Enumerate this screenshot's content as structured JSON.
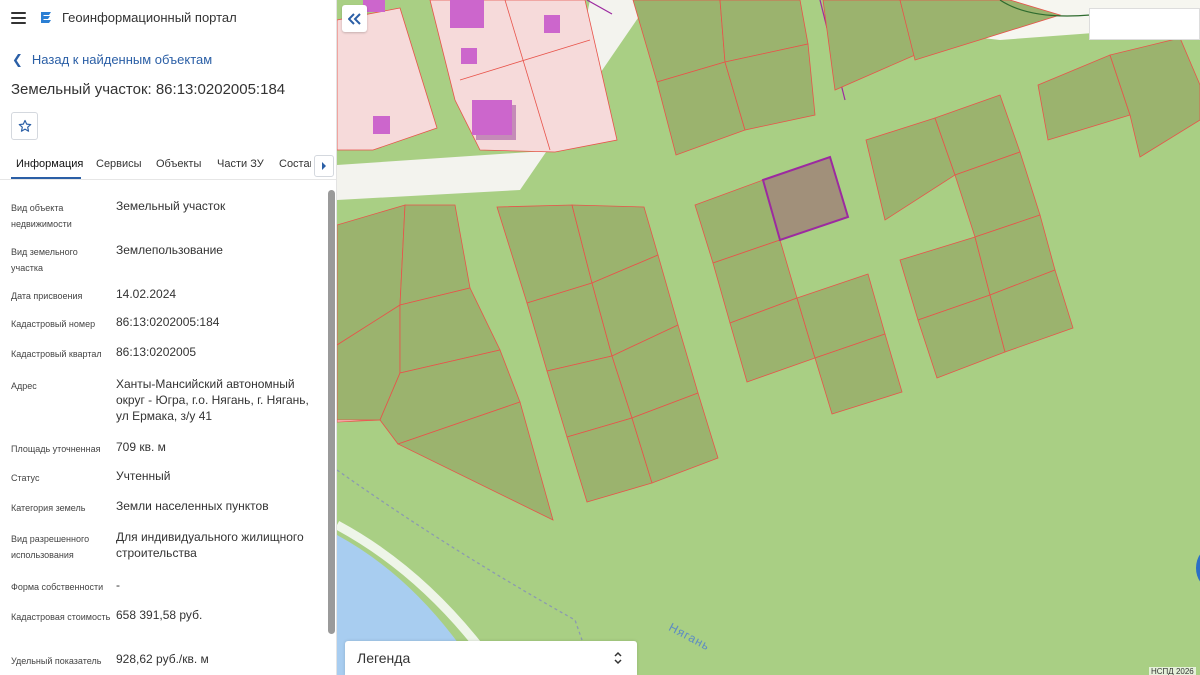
{
  "header": {
    "title": "Геоинформационный портал",
    "menu_icon": "hamburger-icon",
    "logo_icon": "portal-logo-icon"
  },
  "nav": {
    "back_label": "Назад к найденным объектам",
    "back_icon": "chevron-left-icon"
  },
  "object": {
    "title": "Земельный участок: 86:13:0202005:184",
    "favorite_icon": "star-outline-icon"
  },
  "tabs": [
    {
      "label": "Информация",
      "active": true
    },
    {
      "label": "Сервисы",
      "active": false
    },
    {
      "label": "Объекты",
      "active": false
    },
    {
      "label": "Части ЗУ",
      "active": false
    },
    {
      "label": "Состав",
      "active": false
    }
  ],
  "tabs_more_icon": "caret-right-icon",
  "properties": [
    {
      "label": "Вид объекта недвижимости",
      "value": "Земельный участок"
    },
    {
      "label": "Вид земельного участка",
      "value": "Землепользование"
    },
    {
      "label": "Дата присвоения",
      "value": "14.02.2024"
    },
    {
      "label": "Кадастровый номер",
      "value": "86:13:0202005:184"
    },
    {
      "label": "Кадастровый квартал",
      "value": "86:13:0202005"
    },
    {
      "label": "Адрес",
      "value": "Ханты-Мансийский автономный округ - Югра, г.о. Нягань, г. Нягань, ул Ермака, з/у 41"
    },
    {
      "label": "Площадь уточненная",
      "value": "709 кв. м"
    },
    {
      "label": "Статус",
      "value": "Учтенный"
    },
    {
      "label": "Категория земель",
      "value": "Земли населенных пунктов"
    },
    {
      "label": "Вид разрешенного использования",
      "value": "Для индивидуального жилищного строительства"
    },
    {
      "label": "Форма собственности",
      "value": "-"
    },
    {
      "label": "Кадастровая стоимость",
      "value": "658 391,58 руб."
    },
    {
      "label": "Удельный показатель",
      "value": "928,62 руб./кв. м"
    }
  ],
  "map": {
    "collapse_icon": "double-chevron-left-icon",
    "legend_label": "Легенда",
    "legend_icon": "select-arrows-icon",
    "attribution": "НСПД 2026",
    "river_label": "Нягань",
    "colors": {
      "ground": "#a9cf84",
      "parcel_fill": "#9bb36e",
      "parcel_stroke": "#e8534a",
      "selected_stroke": "#9c2aa0",
      "selected_fill": "#a1907a",
      "building": "#cc66cc",
      "residential": "#f6dada",
      "road": "#f3f3ee",
      "water": "#a8cdf0",
      "accent": "#2b5fa6"
    }
  }
}
